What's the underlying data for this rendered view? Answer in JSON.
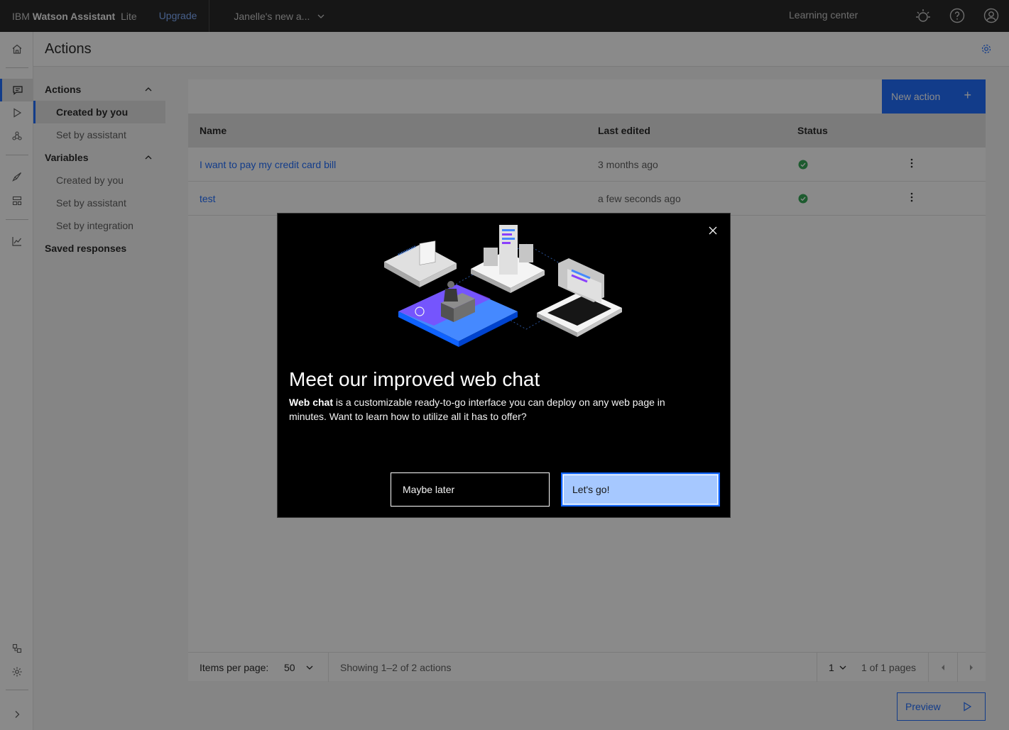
{
  "header": {
    "brand_prefix": "IBM",
    "brand_name": "Watson Assistant",
    "brand_plan": "Lite",
    "upgrade_label": "Upgrade",
    "assistant_name": "Janelle's new a...",
    "learning_center": "Learning center",
    "icons": [
      "watson-icon",
      "help-icon",
      "user-avatar-icon"
    ]
  },
  "rail": {
    "icons": [
      "home-icon",
      "actions-icon",
      "preview-icon",
      "integrations-icon",
      "publish-icon",
      "environments-icon",
      "analytics-icon",
      "notifications-icon",
      "settings-icon",
      "expand-icon"
    ]
  },
  "page": {
    "title": "Actions"
  },
  "subnav": {
    "actions_group": "Actions",
    "actions_items": [
      "Created by you",
      "Set by assistant"
    ],
    "variables_group": "Variables",
    "variables_items": [
      "Created by you",
      "Set by assistant",
      "Set by integration"
    ],
    "saved_responses": "Saved responses"
  },
  "main": {
    "new_action_label": "New action",
    "columns": [
      "Name",
      "Last edited",
      "Status"
    ],
    "rows": [
      {
        "name": "I want to pay my credit card bill",
        "last_edited": "3 months ago"
      },
      {
        "name": "test",
        "last_edited": "a few seconds ago"
      }
    ]
  },
  "pagination": {
    "items_per_page_label": "Items per page:",
    "items_per_page_value": "50",
    "showing": "Showing 1–2 of 2 actions",
    "page_value": "1",
    "of_pages": "1 of 1 pages"
  },
  "preview_label": "Preview",
  "modal": {
    "title": "Meet our improved web chat",
    "body_bold": "Web chat",
    "body_rest": " is a customizable ready-to-go interface you can deploy on any web page in minutes. Want to learn how to utilize all it has to offer?",
    "secondary_label": "Maybe later",
    "primary_label": "Let's go!"
  },
  "colors": {
    "accent": "#0f62fe",
    "header_bg": "#161616",
    "success": "#24a148",
    "primary_button": "#a6c8ff"
  }
}
